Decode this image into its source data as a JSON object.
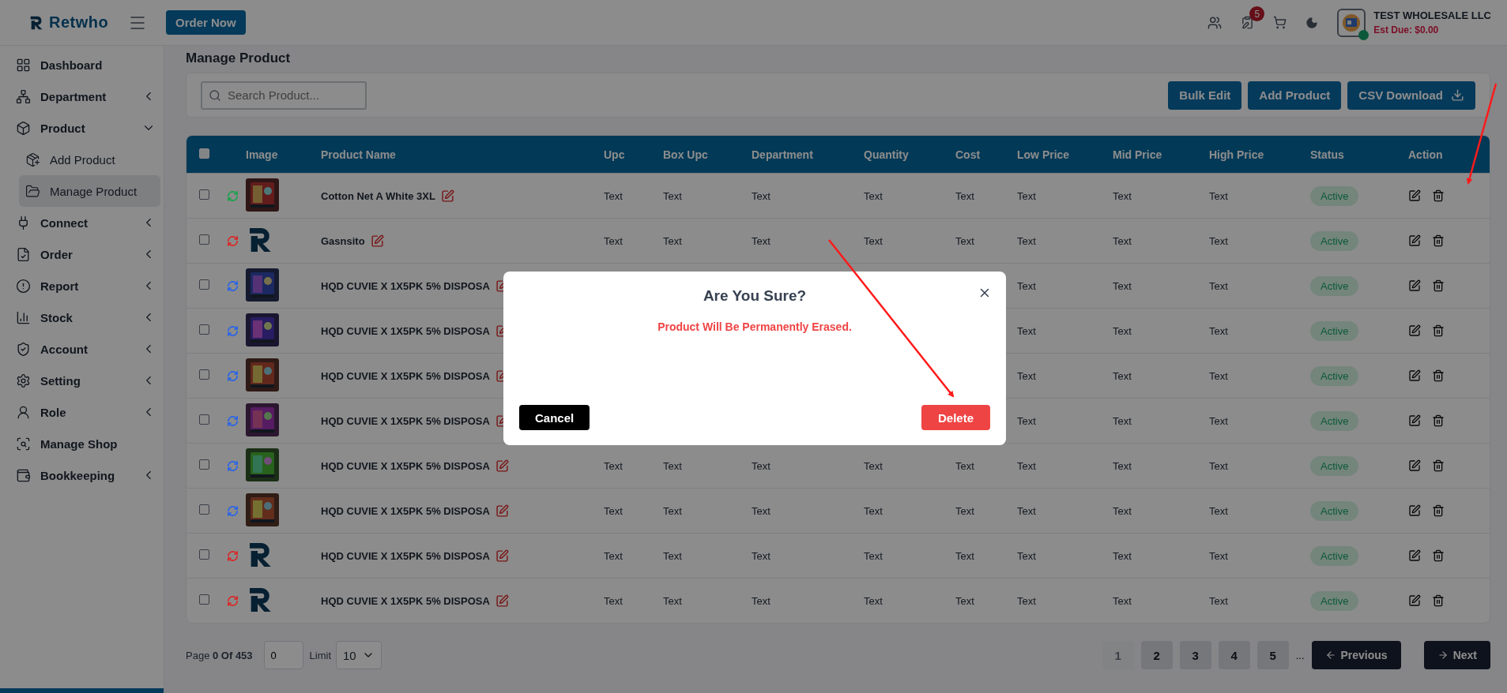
{
  "header": {
    "logo": "Retwho",
    "order_button": "Order Now",
    "notification_count": "5",
    "account_name": "TEST WHOLESALE LLC",
    "est_due": "Est Due: $0.00",
    "online": true
  },
  "sidebar": {
    "items": [
      {
        "label": "Dashboard",
        "selected": false
      },
      {
        "label": "Department",
        "selected": false,
        "expanded": false
      },
      {
        "label": "Product",
        "selected": false,
        "expanded": true,
        "children": [
          {
            "label": "Add Product",
            "selected": false
          },
          {
            "label": "Manage Product",
            "selected": true
          }
        ]
      },
      {
        "label": "Connect",
        "selected": false,
        "expanded": false
      },
      {
        "label": "Order",
        "selected": false,
        "expanded": false
      },
      {
        "label": "Report",
        "selected": false,
        "expanded": false
      },
      {
        "label": "Stock",
        "selected": false,
        "expanded": false
      },
      {
        "label": "Account",
        "selected": false,
        "expanded": false
      },
      {
        "label": "Setting",
        "selected": false,
        "expanded": false
      },
      {
        "label": "Role",
        "selected": false,
        "expanded": false
      },
      {
        "label": "Manage Shop",
        "selected": false
      },
      {
        "label": "Bookkeeping",
        "selected": false,
        "expanded": false
      }
    ]
  },
  "page_title": "Manage Product",
  "toolbar": {
    "search": {
      "placeholder": "Search Product..."
    },
    "buttons": [
      "Bulk Edit",
      "Add Product",
      "CSV Download"
    ]
  },
  "table": {
    "header_checked": false,
    "columns": [
      "Image",
      "Product Name",
      "Upc",
      "Box Upc",
      "Department",
      "Quantity",
      "Cost",
      "Low Price",
      "Mid Price",
      "High Price",
      "Status",
      "Action"
    ],
    "rows": [
      {
        "checked": false,
        "color": "#16a34a",
        "kind": "picture",
        "name": "Cotton Net A White 3XL",
        "values": {
          "upc": "Text",
          "box_upc": "Text",
          "department": "Text",
          "quantity": "Text",
          "cost": "Text",
          "low_price": "Text",
          "mid_price": "Text",
          "high_price": "Text"
        },
        "status": "Active"
      },
      {
        "checked": false,
        "color": "#dc2626",
        "kind": "logo",
        "name": "Gasnsito",
        "values": {
          "upc": "Text",
          "box_upc": "Text",
          "department": "Text",
          "quantity": "Text",
          "cost": "Text",
          "low_price": "Text",
          "mid_price": "Text",
          "high_price": "Text"
        },
        "status": "Active"
      },
      {
        "checked": false,
        "color": "#2563eb",
        "kind": "picture",
        "name": "HQD CUVIE X 1X5PK 5% DISPOSA",
        "values": {
          "low_price": "Text",
          "mid_price": "Text",
          "high_price": "Text"
        },
        "status": "Active"
      },
      {
        "checked": false,
        "color": "#2563eb",
        "kind": "picture",
        "name": "HQD CUVIE X 1X5PK 5% DISPOSA",
        "values": {
          "low_price": "Text",
          "mid_price": "Text",
          "high_price": "Text"
        },
        "status": "Active"
      },
      {
        "checked": false,
        "color": "#2563eb",
        "kind": "picture",
        "name": "HQD CUVIE X 1X5PK 5% DISPOSA",
        "values": {
          "low_price": "Text",
          "mid_price": "Text",
          "high_price": "Text"
        },
        "status": "Active"
      },
      {
        "checked": false,
        "color": "#2563eb",
        "kind": "picture",
        "name": "HQD CUVIE X 1X5PK 5% DISPOSA",
        "values": {
          "low_price": "Text",
          "mid_price": "Text",
          "high_price": "Text"
        },
        "status": "Active"
      },
      {
        "checked": false,
        "color": "#2563eb",
        "kind": "picture",
        "name": "HQD CUVIE X 1X5PK 5% DISPOSA",
        "values": {
          "upc": "Text",
          "box_upc": "Text",
          "department": "Text",
          "quantity": "Text",
          "cost": "Text",
          "low_price": "Text",
          "mid_price": "Text",
          "high_price": "Text"
        },
        "status": "Active"
      },
      {
        "checked": false,
        "color": "#2563eb",
        "kind": "picture",
        "name": "HQD CUVIE X 1X5PK 5% DISPOSA",
        "values": {
          "upc": "Text",
          "box_upc": "Text",
          "department": "Text",
          "quantity": "Text",
          "cost": "Text",
          "low_price": "Text",
          "mid_price": "Text",
          "high_price": "Text"
        },
        "status": "Active"
      },
      {
        "checked": false,
        "color": "#dc2626",
        "kind": "logo",
        "name": "HQD CUVIE X 1X5PK 5% DISPOSA",
        "values": {
          "upc": "Text",
          "box_upc": "Text",
          "department": "Text",
          "quantity": "Text",
          "cost": "Text",
          "low_price": "Text",
          "mid_price": "Text",
          "high_price": "Text"
        },
        "status": "Active"
      },
      {
        "checked": false,
        "color": "#dc2626",
        "kind": "logo",
        "name": "HQD CUVIE X 1X5PK 5% DISPOSA",
        "values": {
          "upc": "Text",
          "box_upc": "Text",
          "department": "Text",
          "quantity": "Text",
          "cost": "Text",
          "low_price": "Text",
          "mid_price": "Text",
          "high_price": "Text"
        },
        "status": "Active"
      }
    ]
  },
  "pagination": {
    "page_info": "Page **0 Of 453**",
    "page_input": "0",
    "limit_label": "Limit",
    "limit_value": "10",
    "pages": [
      {
        "label": "1",
        "selected": true
      },
      {
        "label": "2",
        "selected": false
      },
      {
        "label": "3",
        "selected": false
      },
      {
        "label": "4",
        "selected": false
      },
      {
        "label": "5",
        "selected": false
      }
    ],
    "ellipsis": "...",
    "previous": "Previous",
    "next": "Next"
  },
  "modal": {
    "title": "Are You Sure?",
    "message": "Product Will Be Permanently Erased.",
    "cancel": "Cancel",
    "confirm": "Delete"
  }
}
